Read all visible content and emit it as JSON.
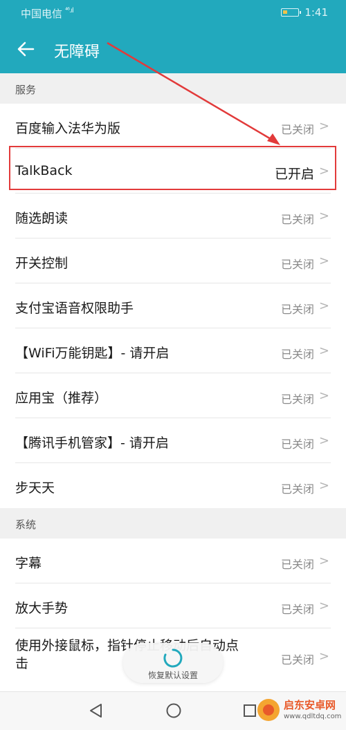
{
  "status_bar": {
    "carrier": "中国电信",
    "signal_label": "⁴⁶.ıl",
    "time": "1:41"
  },
  "header": {
    "back_icon": "arrow-left-icon",
    "title": "无障碍"
  },
  "sections": {
    "services": {
      "title": "服务",
      "items": [
        {
          "label": "百度输入法华为版",
          "status": "已关闭"
        },
        {
          "label": "TalkBack",
          "status": "已开启"
        },
        {
          "label": "随选朗读",
          "status": "已关闭"
        },
        {
          "label": "开关控制",
          "status": "已关闭"
        },
        {
          "label": "支付宝语音权限助手",
          "status": "已关闭"
        },
        {
          "label": "【WiFi万能钥匙】- 请开启",
          "status": "已关闭"
        },
        {
          "label": "应用宝（推荐）",
          "status": "已关闭"
        },
        {
          "label": "【腾讯手机管家】- 请开启",
          "status": "已关闭"
        },
        {
          "label": "步天天",
          "status": "已关闭"
        }
      ]
    },
    "system": {
      "title": "系统",
      "items": [
        {
          "label": "字幕",
          "status": "已关闭"
        },
        {
          "label": "放大手势",
          "status": "已关闭"
        },
        {
          "label": "使用外接鼠标，指针停止移动后自动点击",
          "status": "已关闭"
        }
      ]
    }
  },
  "toast": {
    "label": "恢复默认设置",
    "icon": "loading-spinner-icon"
  },
  "watermark": {
    "text": "启东安卓网",
    "url": "www.qdltdq.com"
  },
  "colors": {
    "header": "#22a9bd",
    "highlight": "#e23a3a"
  }
}
